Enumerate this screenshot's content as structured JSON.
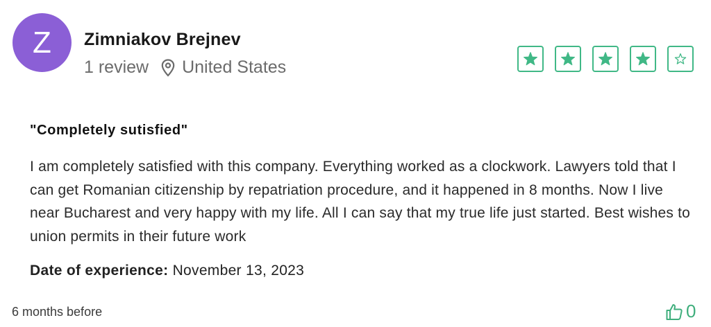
{
  "reviewer": {
    "initial": "Z",
    "name": "Zimniakov Brejnev",
    "reviews": "1 review",
    "location": "United States",
    "avatar_color": "#8b5fd6"
  },
  "rating": {
    "value": 4,
    "max": 5,
    "accent": "#40b886"
  },
  "review": {
    "title": "\"Completely sutisfied\"",
    "text": "I am completely satisfied with this company. Everything worked as a clockwork. Lawyers told that I can get Romanian citizenship by repatriation procedure, and it happened in 8 months. Now I live near Bucharest and very happy with my life. All I can say that my true life just started. Best wishes to union permits in their future work",
    "experience_label": "Date of experience:",
    "experience_date": "November 13, 2023"
  },
  "footer": {
    "posted": "6 months before",
    "useful_count": "0",
    "useful_icon": "thumbs-up-icon"
  }
}
